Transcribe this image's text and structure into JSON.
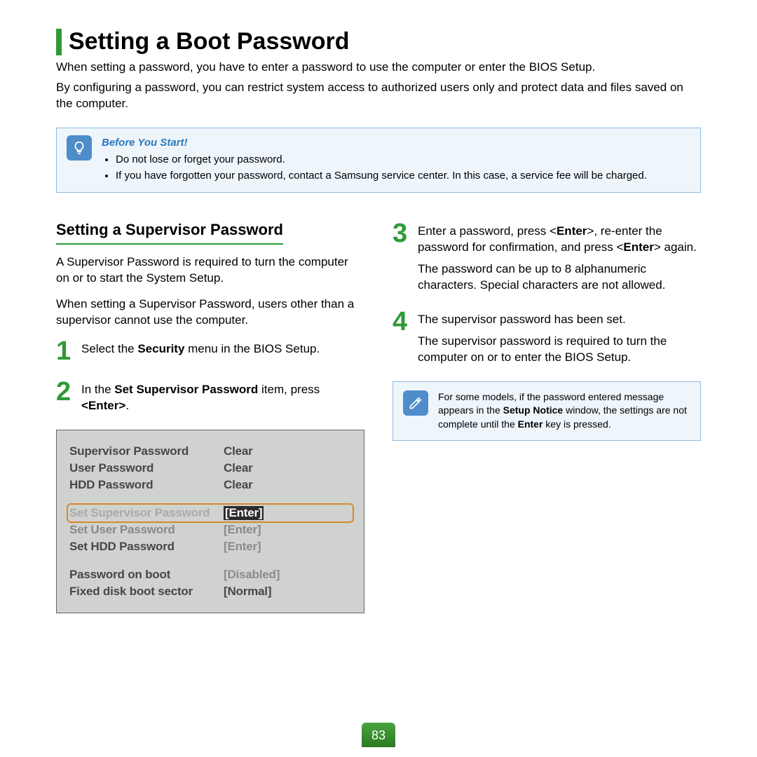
{
  "title": "Setting a Boot Password",
  "intro1": "When setting a password, you have to enter a password to use the computer or enter the BIOS Setup.",
  "intro2": "By configuring a password, you can restrict system access to authorized users only and protect data and files saved on the computer.",
  "before": {
    "title": "Before You Start!",
    "items": [
      "Do not lose or forget your password.",
      "If you have forgotten your password, contact a Samsung service center. In this case, a service fee will be charged."
    ]
  },
  "left": {
    "heading": "Setting a Supervisor Password",
    "p1": "A Supervisor Password is required to turn the computer on or to start the System Setup.",
    "p2": "When setting a Supervisor Password, users other than a supervisor cannot use the computer.",
    "step1_pre": "Select the ",
    "step1_bold": "Security",
    "step1_post": " menu in the BIOS Setup.",
    "step2_pre": "In the ",
    "step2_bold": "Set Supervisor Password",
    "step2_mid": " item, press ",
    "step2_key": "<Enter>",
    "step2_post": "."
  },
  "bios": {
    "rows1": [
      {
        "label": "Supervisor Password",
        "value": "Clear"
      },
      {
        "label": "User Password",
        "value": "Clear"
      },
      {
        "label": "HDD Password",
        "value": "Clear"
      }
    ],
    "highlight": {
      "label": "Set Supervisor Password",
      "value": "[Enter]"
    },
    "under": {
      "label": "Set User Password",
      "value": "[Enter]"
    },
    "row2": {
      "label": "Set HDD Password",
      "value": "[Enter]"
    },
    "rows3": [
      {
        "label": "Password on boot",
        "value": "[Disabled]"
      },
      {
        "label": "Fixed disk boot sector",
        "value": "[Normal]"
      }
    ]
  },
  "right": {
    "step3_a": "Enter a password, press <",
    "step3_b1": "Enter",
    "step3_c": ">, re-enter the password for confirmation, and press <",
    "step3_b2": "Enter",
    "step3_d": "> again.",
    "step3_p2": "The password can be up to 8 alphanumeric characters. Special characters are not allowed.",
    "step4_p1": "The supervisor password has been set.",
    "step4_p2": "The supervisor password is required to turn the computer on or to enter the BIOS Setup.",
    "note_a": "For some models, if the password entered message appears in the ",
    "note_b1": "Setup Notice",
    "note_c": " window, the settings are not complete until the ",
    "note_b2": "Enter",
    "note_d": " key is pressed."
  },
  "page": "83"
}
